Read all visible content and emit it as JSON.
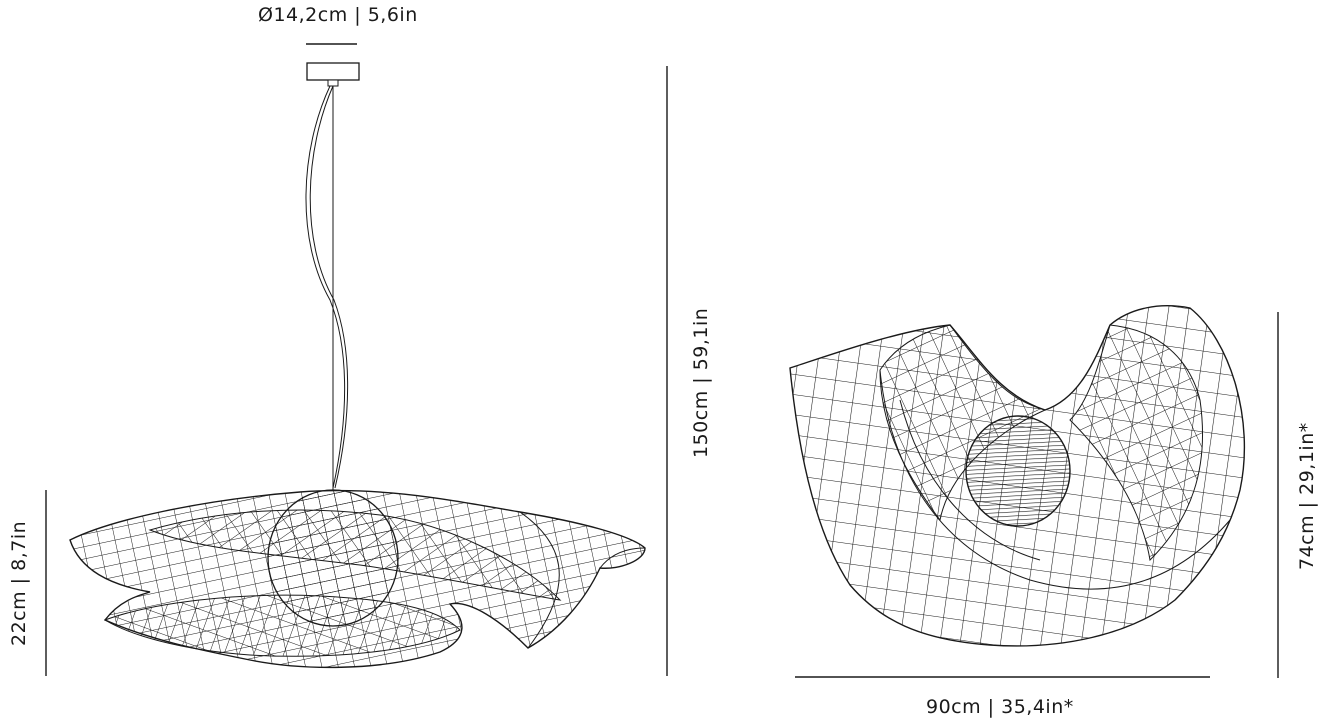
{
  "dimensions": {
    "canopy_diameter": "Ø14,2cm | 5,6in",
    "shade_height": "22cm | 8,7in",
    "total_height": "150cm | 59,1in",
    "side_height": "74cm | 29,1in*",
    "side_width": "90cm | 35,4in*"
  }
}
